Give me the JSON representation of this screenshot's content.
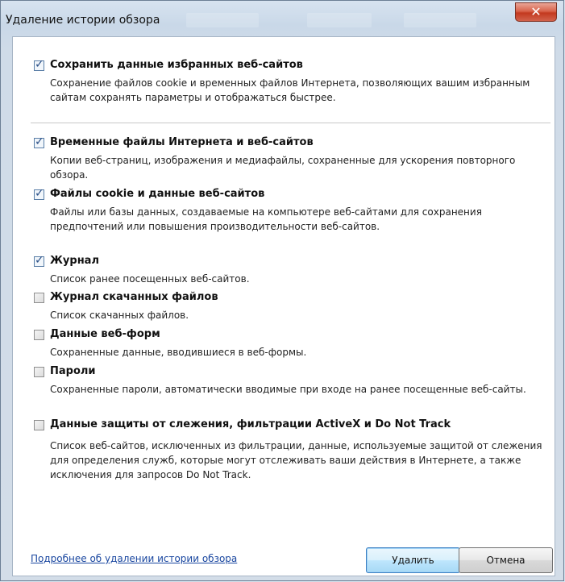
{
  "window": {
    "title": "Удаление истории обзора",
    "close_glyph": "✕"
  },
  "options": [
    {
      "title": "Сохранить данные избранных веб-сайтов",
      "description": "Сохранение файлов cookie и временных файлов Интернета, позволяющих вашим избранным сайтам сохранять параметры и отображаться быстрее.",
      "checked": true
    },
    {
      "title": "Временные файлы Интернета и веб-сайтов",
      "description": "Копии веб-страниц, изображения и медиафайлы, сохраненные для ускорения повторного обзора.",
      "checked": true
    },
    {
      "title": "Файлы cookie и данные веб-сайтов",
      "description": "Файлы или базы данных, создаваемые на компьютере веб-сайтами для сохранения предпочтений или повышения производительности веб-сайтов.",
      "checked": true
    },
    {
      "title": "Журнал",
      "description": "Список ранее посещенных веб-сайтов.",
      "checked": true
    },
    {
      "title": "Журнал скачанных файлов",
      "description": "Список скачанных файлов.",
      "checked": false
    },
    {
      "title": "Данные веб-форм",
      "description": "Сохраненные данные, вводившиеся в веб-формы.",
      "checked": false
    },
    {
      "title": "Пароли",
      "description": "Сохраненные пароли, автоматически вводимые при входе на ранее посещенные веб-сайты.",
      "checked": false
    },
    {
      "title": "Данные защиты от слежения, фильтрации ActiveX и Do Not Track",
      "description": "Список веб-сайтов, исключенных из фильтрации, данные, используемые защитой от слежения для определения служб, которые могут отслеживать ваши действия в Интернете, а также исключения для запросов Do Not Track.",
      "checked": false
    }
  ],
  "footer": {
    "help_link": "Подробнее об удалении истории обзора",
    "delete_button": "Удалить",
    "cancel_button": "Отмена"
  }
}
